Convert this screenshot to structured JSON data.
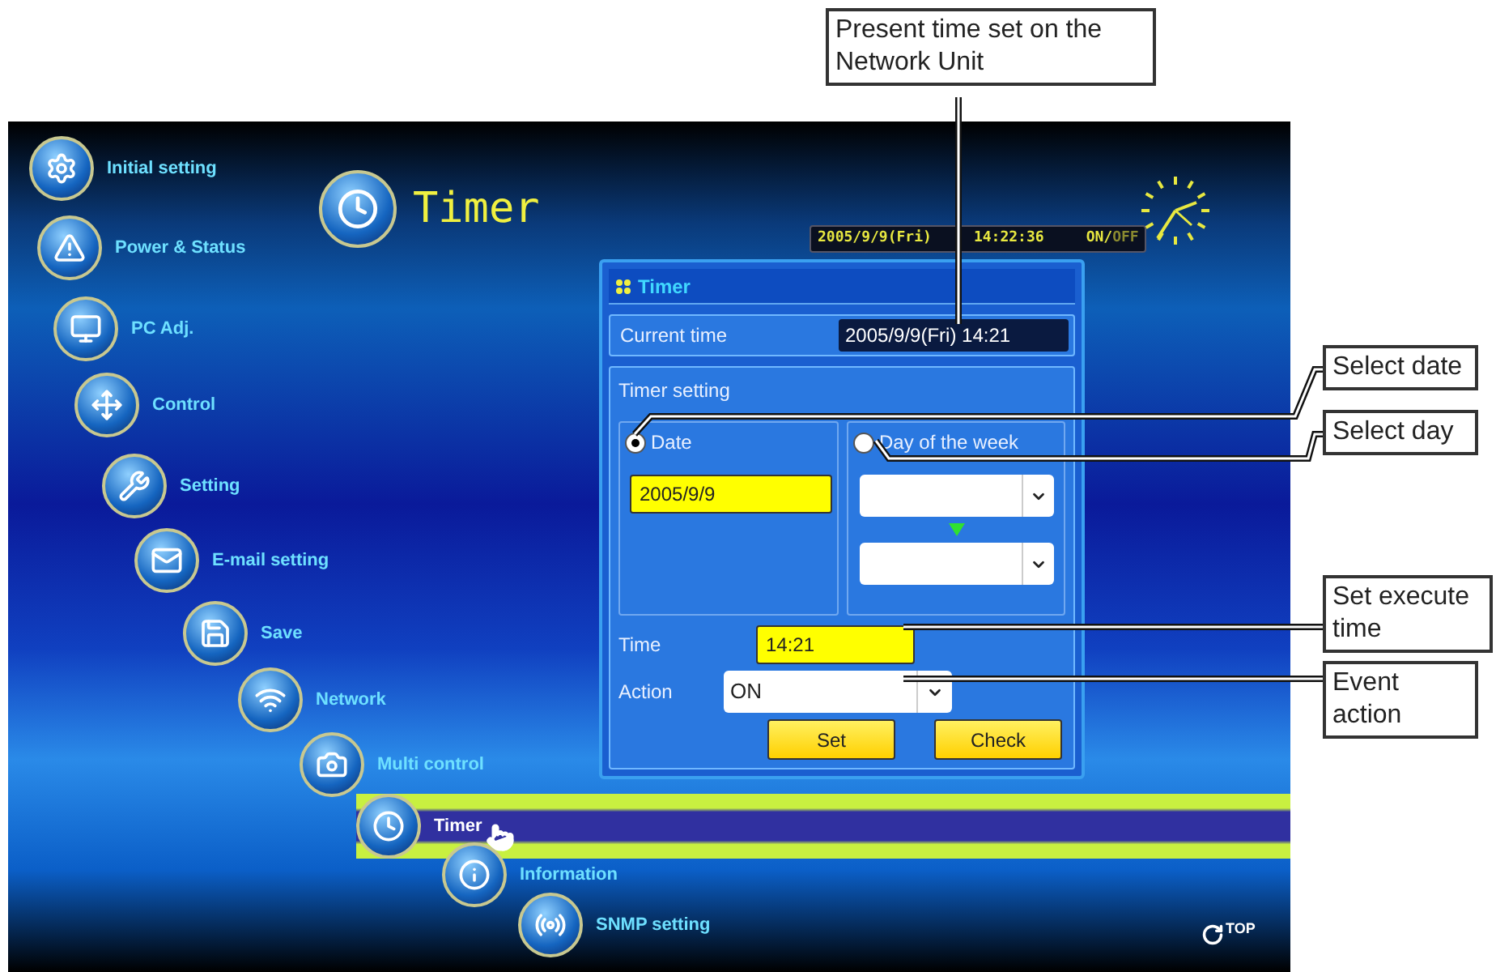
{
  "callouts": [
    {
      "text": "Present time set on the Network Unit"
    },
    {
      "text": "Select date"
    },
    {
      "text": "Select day"
    },
    {
      "text": "Set execute time"
    },
    {
      "text": "Event action"
    }
  ],
  "menu": [
    {
      "label": "Initial setting",
      "selected": false
    },
    {
      "label": "Power & Status",
      "selected": false
    },
    {
      "label": "PC Adj.",
      "selected": false
    },
    {
      "label": "Control",
      "selected": false
    },
    {
      "label": "Setting",
      "selected": false
    },
    {
      "label": "E-mail setting",
      "selected": false
    },
    {
      "label": "Save",
      "selected": false
    },
    {
      "label": "Network",
      "selected": false
    },
    {
      "label": "Multi control",
      "selected": false
    },
    {
      "label": "Timer",
      "selected": true
    },
    {
      "label": "Information",
      "selected": false
    },
    {
      "label": "SNMP setting",
      "selected": false
    }
  ],
  "header": {
    "title": "Timer"
  },
  "status_bar": {
    "date": "2005/9/9(Fri)",
    "time": "14:22:36",
    "on": "ON/",
    "off": "OFF"
  },
  "panel": {
    "title": "Timer",
    "current_time_label": "Current time",
    "current_time": "2005/9/9(Fri) 14:21",
    "timer_setting_label": "Timer setting",
    "modes": [
      {
        "label": "Date",
        "selected": true
      },
      {
        "label": "Day of the week",
        "selected": false
      }
    ],
    "date_value": "2005/9/9",
    "time_label": "Time",
    "time_value": "14:21",
    "action_label": "Action",
    "action_value": "ON",
    "buttons": [
      "Set",
      "Check"
    ]
  },
  "top_link": "TOP"
}
